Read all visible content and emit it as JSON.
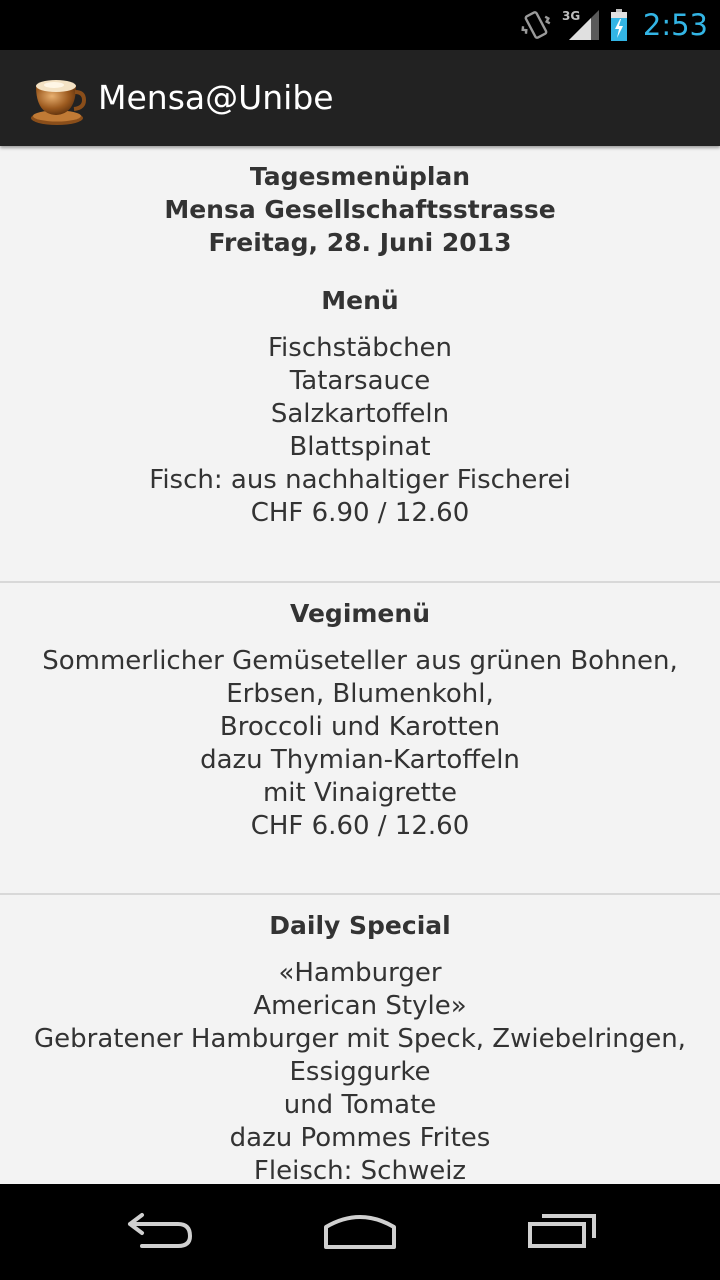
{
  "status_bar": {
    "network": "3G",
    "time": "2:53",
    "icons": [
      "vibrate-icon",
      "signal-icon",
      "battery-charging-icon"
    ]
  },
  "action_bar": {
    "icon": "coffee-cup-icon",
    "title": "Mensa@Unibe"
  },
  "header": {
    "title": "Tagesmenüplan",
    "location": "Mensa Gesellschaftsstrasse",
    "date": "Freitag, 28. Juni 2013"
  },
  "sections": [
    {
      "title": "Menü",
      "lines": [
        "Fischstäbchen",
        "Tatarsauce",
        "Salzkartoffeln",
        "Blattspinat",
        "Fisch: aus nachhaltiger Fischerei",
        "CHF 6.90 / 12.60"
      ]
    },
    {
      "title": "Vegimenü",
      "lines": [
        "Sommerlicher Gemüseteller aus grünen Bohnen,",
        "Erbsen, Blumenkohl,",
        "Broccoli und Karotten",
        "dazu Thymian-Kartoffeln",
        "mit Vinaigrette",
        "CHF 6.60 / 12.60"
      ]
    },
    {
      "title": "Daily Special",
      "lines": [
        "«Hamburger",
        "American Style»",
        "Gebratener Hamburger mit Speck, Zwiebelringen,",
        "Essiggurke",
        "und Tomate",
        "dazu Pommes Frites",
        "Fleisch: Schweiz"
      ]
    }
  ],
  "nav_bar": {
    "icons": [
      "back-icon",
      "home-icon",
      "recent-apps-icon"
    ]
  },
  "colors": {
    "accent": "#33b5e5",
    "action_bar": "#222222",
    "background": "#f3f3f3",
    "text": "#333333"
  }
}
